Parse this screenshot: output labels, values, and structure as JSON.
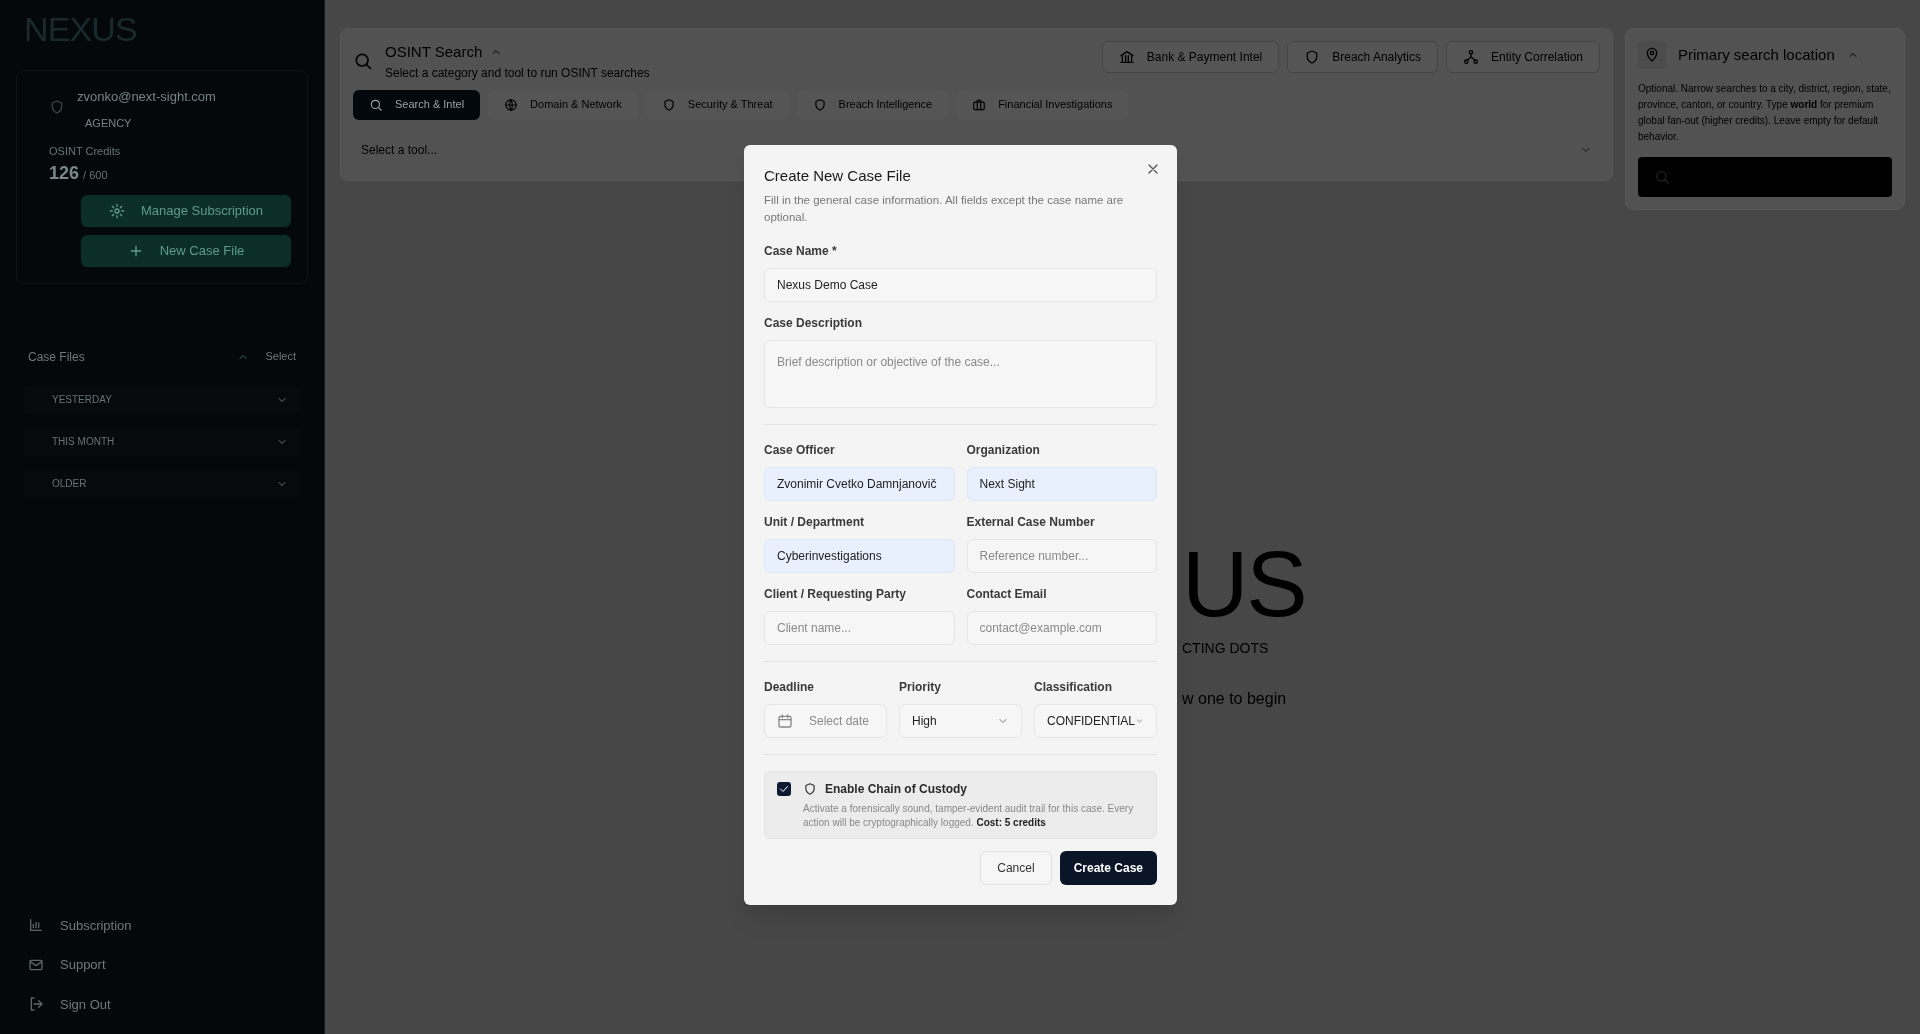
{
  "sidebar": {
    "logo": "NEXUS",
    "account": {
      "email": "zvonko@next-sight.com",
      "plan": "AGENCY"
    },
    "credits": {
      "label": "OSINT Credits",
      "used": "126",
      "total": "/ 600"
    },
    "buttons": [
      "Manage Subscription",
      "New Case File"
    ],
    "case_files": {
      "title": "Case Files",
      "action": "Select",
      "expanded": true,
      "groups": [
        {
          "label": "YESTERDAY",
          "expanded": false
        },
        {
          "label": "THIS MONTH",
          "expanded": false
        },
        {
          "label": "OLDER",
          "expanded": false
        }
      ]
    },
    "footer_items": [
      "Subscription",
      "Support",
      "Sign Out"
    ]
  },
  "search_panel": {
    "title": "OSINT Search",
    "subtitle": "Select a category and tool to run OSINT searches",
    "expanded": true,
    "quick_tools": [
      "Bank & Payment Intel",
      "Breach Analytics",
      "Entity Correlation"
    ],
    "categories": [
      {
        "label": "Search & Intel",
        "selected": true
      },
      {
        "label": "Domain & Network",
        "selected": false
      },
      {
        "label": "Security & Threat",
        "selected": false
      },
      {
        "label": "Breach Intelligence",
        "selected": false
      },
      {
        "label": "Financial Investigations",
        "selected": false
      }
    ],
    "tool_select": {
      "placeholder": "Select a tool..."
    }
  },
  "location_panel": {
    "title": "Primary search location",
    "expanded": true,
    "description": "Optional. Narrow searches to a city, district, region, state, province, canton, or country. Type **world** for premium global fan-out (higher credits). Leave empty for default behavior."
  },
  "splash": {
    "logo_fragment": "US",
    "tagline_fragment": "CTING DOTS",
    "hint_fragment": "w one to begin"
  },
  "modal": {
    "title": "Create New Case File",
    "subtitle": "Fill in the general case information. All fields except the case name are optional.",
    "sections": [
      {
        "fields": [
          {
            "kind": "text",
            "label": "Case Name *",
            "value": "Nexus Demo Case",
            "autofilled": false
          },
          {
            "kind": "textarea",
            "label": "Case Description",
            "placeholder": "Brief description or objective of the case...",
            "autofilled": false
          }
        ]
      },
      {
        "fields": [
          {
            "kind": "text",
            "label": "Case Officer",
            "value": "Zvonimir Cvetko Damnjanovič",
            "autofilled": true
          },
          {
            "kind": "text",
            "label": "Organization",
            "value": "Next Sight",
            "autofilled": true
          },
          {
            "kind": "text",
            "label": "Unit / Department",
            "value": "Cyberinvestigations",
            "autofilled": true
          },
          {
            "kind": "text",
            "label": "External Case Number",
            "placeholder": "Reference number...",
            "autofilled": false
          },
          {
            "kind": "text",
            "label": "Client / Requesting Party",
            "placeholder": "Client name...",
            "autofilled": false
          },
          {
            "kind": "text",
            "label": "Contact Email",
            "placeholder": "contact@example.com",
            "autofilled": false
          }
        ]
      },
      {
        "fields": [
          {
            "kind": "date",
            "label": "Deadline",
            "placeholder": "Select date",
            "autofilled": false
          },
          {
            "kind": "select",
            "label": "Priority",
            "value": "High",
            "autofilled": false
          },
          {
            "kind": "select",
            "label": "Classification",
            "value": "CONFIDENTIAL",
            "autofilled": false
          }
        ]
      }
    ],
    "custody": {
      "checked": true,
      "title": "Enable Chain of Custody",
      "description": "Activate a forensically sound, tamper-evident audit trail for this case. Every action will be cryptographically logged. **Cost: 5 credits**"
    },
    "buttons": {
      "cancel": "Cancel",
      "submit": "Create Case"
    }
  }
}
